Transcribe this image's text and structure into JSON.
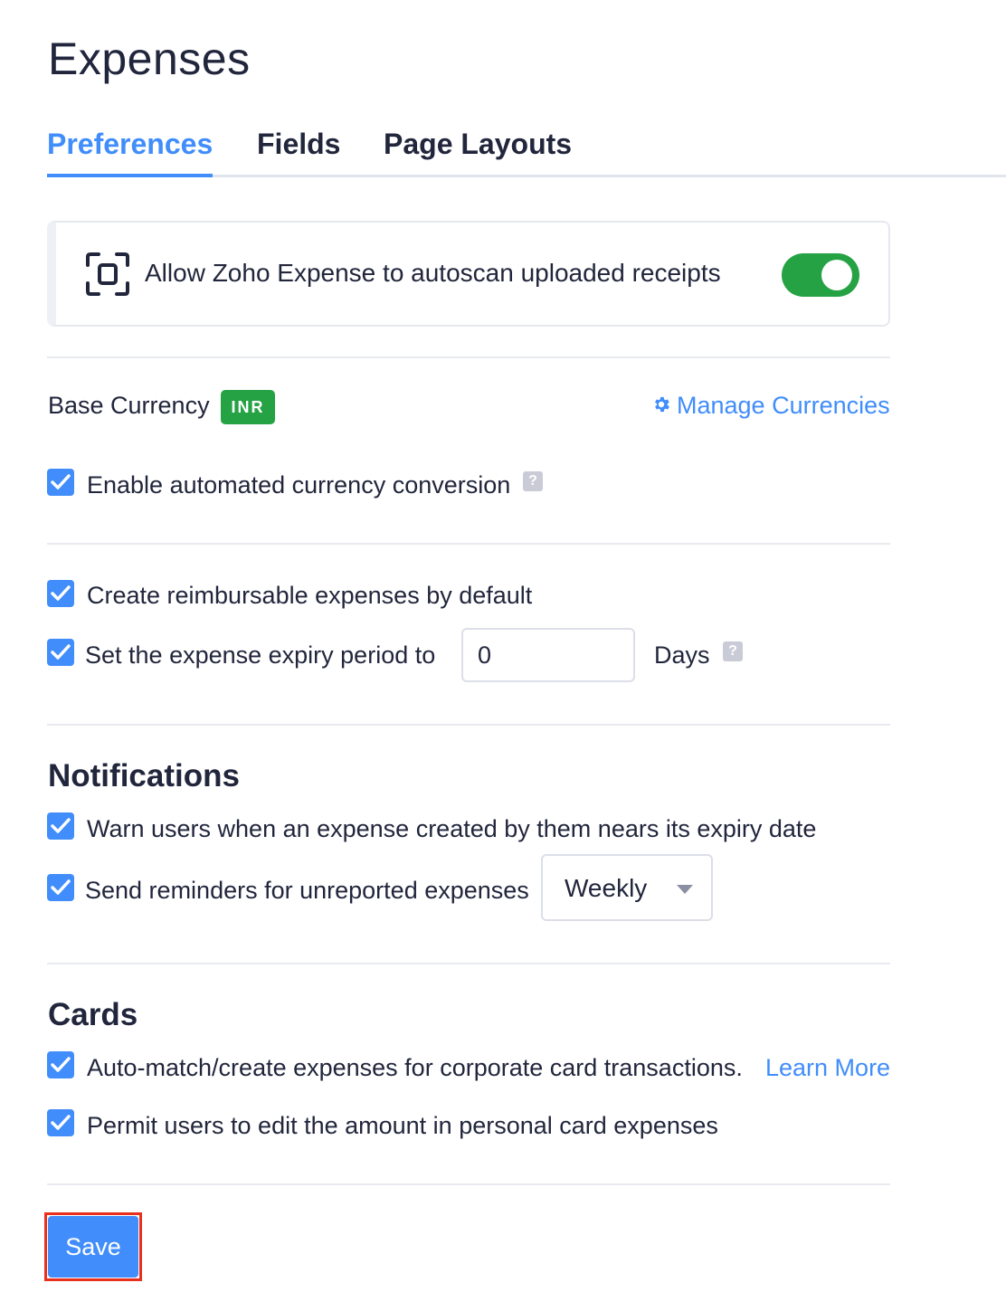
{
  "page_title": "Expenses",
  "tabs": [
    {
      "label": "Preferences",
      "active": true
    },
    {
      "label": "Fields",
      "active": false
    },
    {
      "label": "Page Layouts",
      "active": false
    }
  ],
  "autoscan": {
    "label": "Allow Zoho Expense to autoscan uploaded receipts",
    "enabled": true,
    "icon": "scan-icon"
  },
  "currency": {
    "label": "Base Currency",
    "code": "INR",
    "manage_link": "Manage Currencies",
    "manage_icon": "gear-icon",
    "auto_conversion_label": "Enable automated currency conversion",
    "auto_conversion_checked": true
  },
  "defaults": {
    "reimbursable_label": "Create reimbursable expenses by default",
    "reimbursable_checked": true,
    "expiry_label": "Set the expense expiry period to",
    "expiry_checked": true,
    "expiry_value": "0",
    "expiry_unit": "Days"
  },
  "notifications": {
    "heading": "Notifications",
    "warn_label": "Warn users when an expense created by them nears its expiry date",
    "warn_checked": true,
    "reminder_label": "Send reminders for unreported expenses",
    "reminder_checked": true,
    "reminder_frequency": "Weekly"
  },
  "cards": {
    "heading": "Cards",
    "automatch_label": "Auto-match/create expenses for corporate card transactions.",
    "automatch_checked": true,
    "learn_more": "Learn More",
    "edit_amount_label": "Permit users to edit the amount in personal card expenses",
    "edit_amount_checked": true
  },
  "save_label": "Save",
  "colors": {
    "accent": "#408dfb",
    "success": "#25a244",
    "highlight": "#e8301c"
  }
}
